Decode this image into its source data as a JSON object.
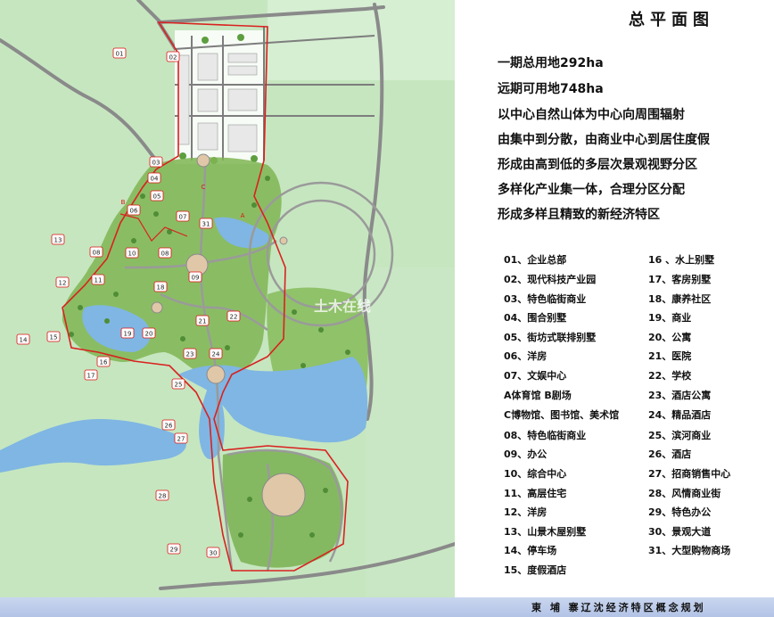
{
  "title": "总平面图",
  "description": [
    "一期总用地292ha",
    "远期可用地748ha",
    "以中心自然山体为中心向周围辐射",
    "由集中到分散，由商业中心到居住度假",
    "形成由高到低的多层次景观视野分区",
    "多样化产业集一体，合理分区分配",
    "形成多样且精致的新经济特区"
  ],
  "legend_left": [
    "01、企业总部",
    "02、现代科技产业园",
    "03、特色临街商业",
    "04、围合别墅",
    "05、街坊式联排别墅",
    "06、洋房",
    "07、文娱中心",
    "A体育馆    B剧场",
    "C博物馆、图书馆、美术馆",
    "08、特色临街商业",
    "09、办公",
    "10、综合中心",
    "11、高层住宅",
    "12、洋房",
    "13、山景木屋别墅",
    "14、停车场",
    "15、度假酒店"
  ],
  "legend_right": [
    "16 、水上别墅",
    "17、客房别墅",
    "18、康养社区",
    "19、商业",
    "20、公寓",
    "21、医院",
    "22、学校",
    "23、酒店公寓",
    "24、精品酒店",
    "25、滨河商业",
    "26、酒店",
    "27、招商销售中心",
    "28、风情商业街",
    "29、特色办公",
    "30、景观大道",
    "31、大型购物商场"
  ],
  "map_labels": [
    "01",
    "02",
    "03",
    "04",
    "05",
    "06",
    "07",
    "08",
    "08",
    "09",
    "10",
    "11",
    "12",
    "13",
    "14",
    "15",
    "16",
    "17",
    "18",
    "19",
    "20",
    "21",
    "22",
    "23",
    "24",
    "25",
    "26",
    "27",
    "28",
    "29",
    "30",
    "31"
  ],
  "map_markers": [
    "B",
    "A",
    "C"
  ],
  "watermark": "土木在线",
  "footer": "東 埔 寨辽沈经济特区概念规划",
  "colors": {
    "boundary": "#d9211f",
    "water": "#7fb6e3",
    "land": "#c9e8c2",
    "road": "#8a8a8a"
  }
}
